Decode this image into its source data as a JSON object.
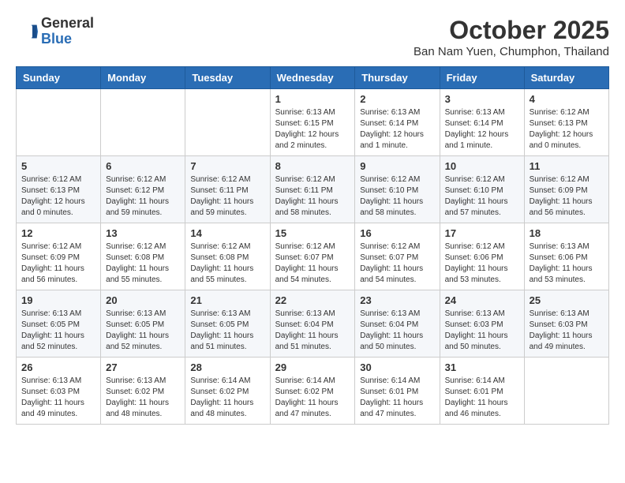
{
  "header": {
    "logo": {
      "general": "General",
      "blue": "Blue"
    },
    "title": "October 2025",
    "location": "Ban Nam Yuen, Chumphon, Thailand"
  },
  "calendar": {
    "days_of_week": [
      "Sunday",
      "Monday",
      "Tuesday",
      "Wednesday",
      "Thursday",
      "Friday",
      "Saturday"
    ],
    "weeks": [
      [
        {
          "day": "",
          "info": ""
        },
        {
          "day": "",
          "info": ""
        },
        {
          "day": "",
          "info": ""
        },
        {
          "day": "1",
          "info": "Sunrise: 6:13 AM\nSunset: 6:15 PM\nDaylight: 12 hours and 2 minutes."
        },
        {
          "day": "2",
          "info": "Sunrise: 6:13 AM\nSunset: 6:14 PM\nDaylight: 12 hours and 1 minute."
        },
        {
          "day": "3",
          "info": "Sunrise: 6:13 AM\nSunset: 6:14 PM\nDaylight: 12 hours and 1 minute."
        },
        {
          "day": "4",
          "info": "Sunrise: 6:12 AM\nSunset: 6:13 PM\nDaylight: 12 hours and 0 minutes."
        }
      ],
      [
        {
          "day": "5",
          "info": "Sunrise: 6:12 AM\nSunset: 6:13 PM\nDaylight: 12 hours and 0 minutes."
        },
        {
          "day": "6",
          "info": "Sunrise: 6:12 AM\nSunset: 6:12 PM\nDaylight: 11 hours and 59 minutes."
        },
        {
          "day": "7",
          "info": "Sunrise: 6:12 AM\nSunset: 6:11 PM\nDaylight: 11 hours and 59 minutes."
        },
        {
          "day": "8",
          "info": "Sunrise: 6:12 AM\nSunset: 6:11 PM\nDaylight: 11 hours and 58 minutes."
        },
        {
          "day": "9",
          "info": "Sunrise: 6:12 AM\nSunset: 6:10 PM\nDaylight: 11 hours and 58 minutes."
        },
        {
          "day": "10",
          "info": "Sunrise: 6:12 AM\nSunset: 6:10 PM\nDaylight: 11 hours and 57 minutes."
        },
        {
          "day": "11",
          "info": "Sunrise: 6:12 AM\nSunset: 6:09 PM\nDaylight: 11 hours and 56 minutes."
        }
      ],
      [
        {
          "day": "12",
          "info": "Sunrise: 6:12 AM\nSunset: 6:09 PM\nDaylight: 11 hours and 56 minutes."
        },
        {
          "day": "13",
          "info": "Sunrise: 6:12 AM\nSunset: 6:08 PM\nDaylight: 11 hours and 55 minutes."
        },
        {
          "day": "14",
          "info": "Sunrise: 6:12 AM\nSunset: 6:08 PM\nDaylight: 11 hours and 55 minutes."
        },
        {
          "day": "15",
          "info": "Sunrise: 6:12 AM\nSunset: 6:07 PM\nDaylight: 11 hours and 54 minutes."
        },
        {
          "day": "16",
          "info": "Sunrise: 6:12 AM\nSunset: 6:07 PM\nDaylight: 11 hours and 54 minutes."
        },
        {
          "day": "17",
          "info": "Sunrise: 6:12 AM\nSunset: 6:06 PM\nDaylight: 11 hours and 53 minutes."
        },
        {
          "day": "18",
          "info": "Sunrise: 6:13 AM\nSunset: 6:06 PM\nDaylight: 11 hours and 53 minutes."
        }
      ],
      [
        {
          "day": "19",
          "info": "Sunrise: 6:13 AM\nSunset: 6:05 PM\nDaylight: 11 hours and 52 minutes."
        },
        {
          "day": "20",
          "info": "Sunrise: 6:13 AM\nSunset: 6:05 PM\nDaylight: 11 hours and 52 minutes."
        },
        {
          "day": "21",
          "info": "Sunrise: 6:13 AM\nSunset: 6:05 PM\nDaylight: 11 hours and 51 minutes."
        },
        {
          "day": "22",
          "info": "Sunrise: 6:13 AM\nSunset: 6:04 PM\nDaylight: 11 hours and 51 minutes."
        },
        {
          "day": "23",
          "info": "Sunrise: 6:13 AM\nSunset: 6:04 PM\nDaylight: 11 hours and 50 minutes."
        },
        {
          "day": "24",
          "info": "Sunrise: 6:13 AM\nSunset: 6:03 PM\nDaylight: 11 hours and 50 minutes."
        },
        {
          "day": "25",
          "info": "Sunrise: 6:13 AM\nSunset: 6:03 PM\nDaylight: 11 hours and 49 minutes."
        }
      ],
      [
        {
          "day": "26",
          "info": "Sunrise: 6:13 AM\nSunset: 6:03 PM\nDaylight: 11 hours and 49 minutes."
        },
        {
          "day": "27",
          "info": "Sunrise: 6:13 AM\nSunset: 6:02 PM\nDaylight: 11 hours and 48 minutes."
        },
        {
          "day": "28",
          "info": "Sunrise: 6:14 AM\nSunset: 6:02 PM\nDaylight: 11 hours and 48 minutes."
        },
        {
          "day": "29",
          "info": "Sunrise: 6:14 AM\nSunset: 6:02 PM\nDaylight: 11 hours and 47 minutes."
        },
        {
          "day": "30",
          "info": "Sunrise: 6:14 AM\nSunset: 6:01 PM\nDaylight: 11 hours and 47 minutes."
        },
        {
          "day": "31",
          "info": "Sunrise: 6:14 AM\nSunset: 6:01 PM\nDaylight: 11 hours and 46 minutes."
        },
        {
          "day": "",
          "info": ""
        }
      ]
    ]
  }
}
